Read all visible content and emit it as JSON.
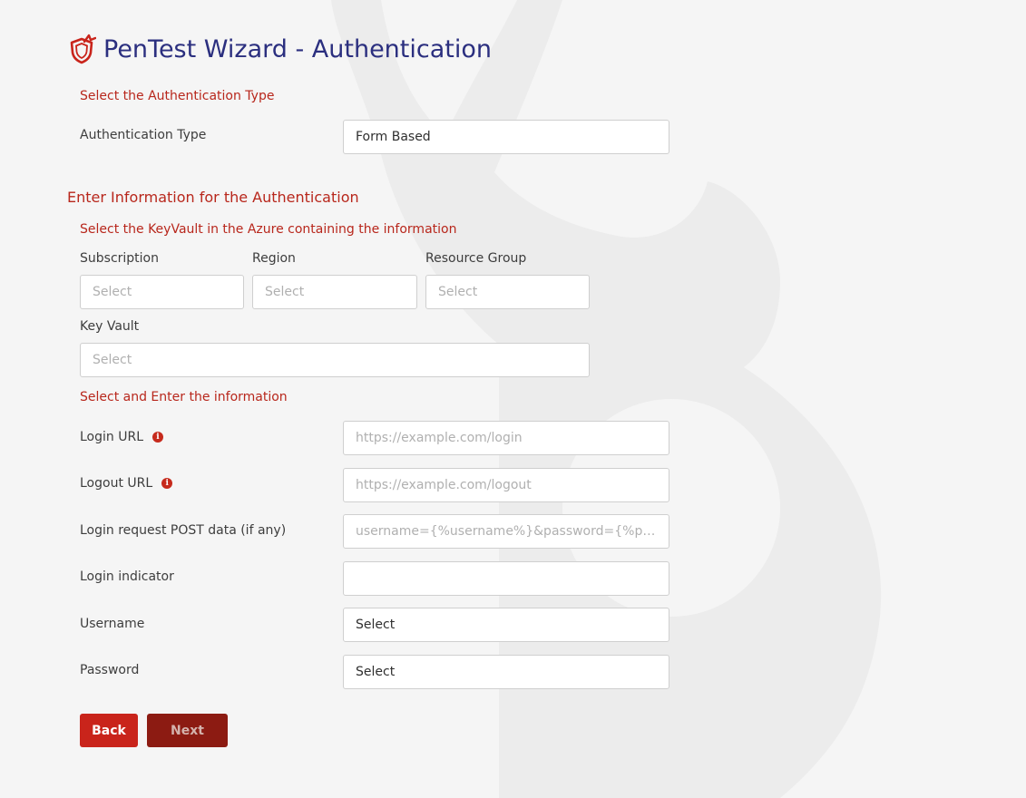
{
  "header": {
    "title": "PenTest Wizard - Authentication",
    "icon": "shield-icon",
    "title_color": "#2b2f7f"
  },
  "auth_type_section": {
    "label": "Select the Authentication Type",
    "field_label": "Authentication Type",
    "value": "Form Based"
  },
  "auth_info": {
    "heading": "Enter Information for the Authentication",
    "keyvault_label": "Select the KeyVault in the Azure containing the information",
    "subscription": {
      "label": "Subscription",
      "placeholder": "Select"
    },
    "region": {
      "label": "Region",
      "placeholder": "Select"
    },
    "resource_group": {
      "label": "Resource Group",
      "placeholder": "Select"
    },
    "key_vault": {
      "label": "Key Vault",
      "placeholder": "Select"
    }
  },
  "details": {
    "label": "Select and Enter the information",
    "login_url": {
      "label": "Login URL",
      "placeholder": "https://example.com/login",
      "icon": "info-icon"
    },
    "logout_url": {
      "label": "Logout URL",
      "placeholder": "https://example.com/logout",
      "icon": "info-icon"
    },
    "post_data": {
      "label": "Login request POST data (if any)",
      "placeholder": "username={%username%}&password={%password%}"
    },
    "login_indicator": {
      "label": "Login indicator",
      "value": ""
    },
    "username": {
      "label": "Username",
      "value": "Select"
    },
    "password": {
      "label": "Password",
      "value": "Select"
    }
  },
  "actions": {
    "back": "Back",
    "next": "Next"
  },
  "colors": {
    "accent": "#c9241b",
    "accent_dark": "#8c1b12",
    "section_label": "#b8271c",
    "background": "#f5f5f5"
  }
}
